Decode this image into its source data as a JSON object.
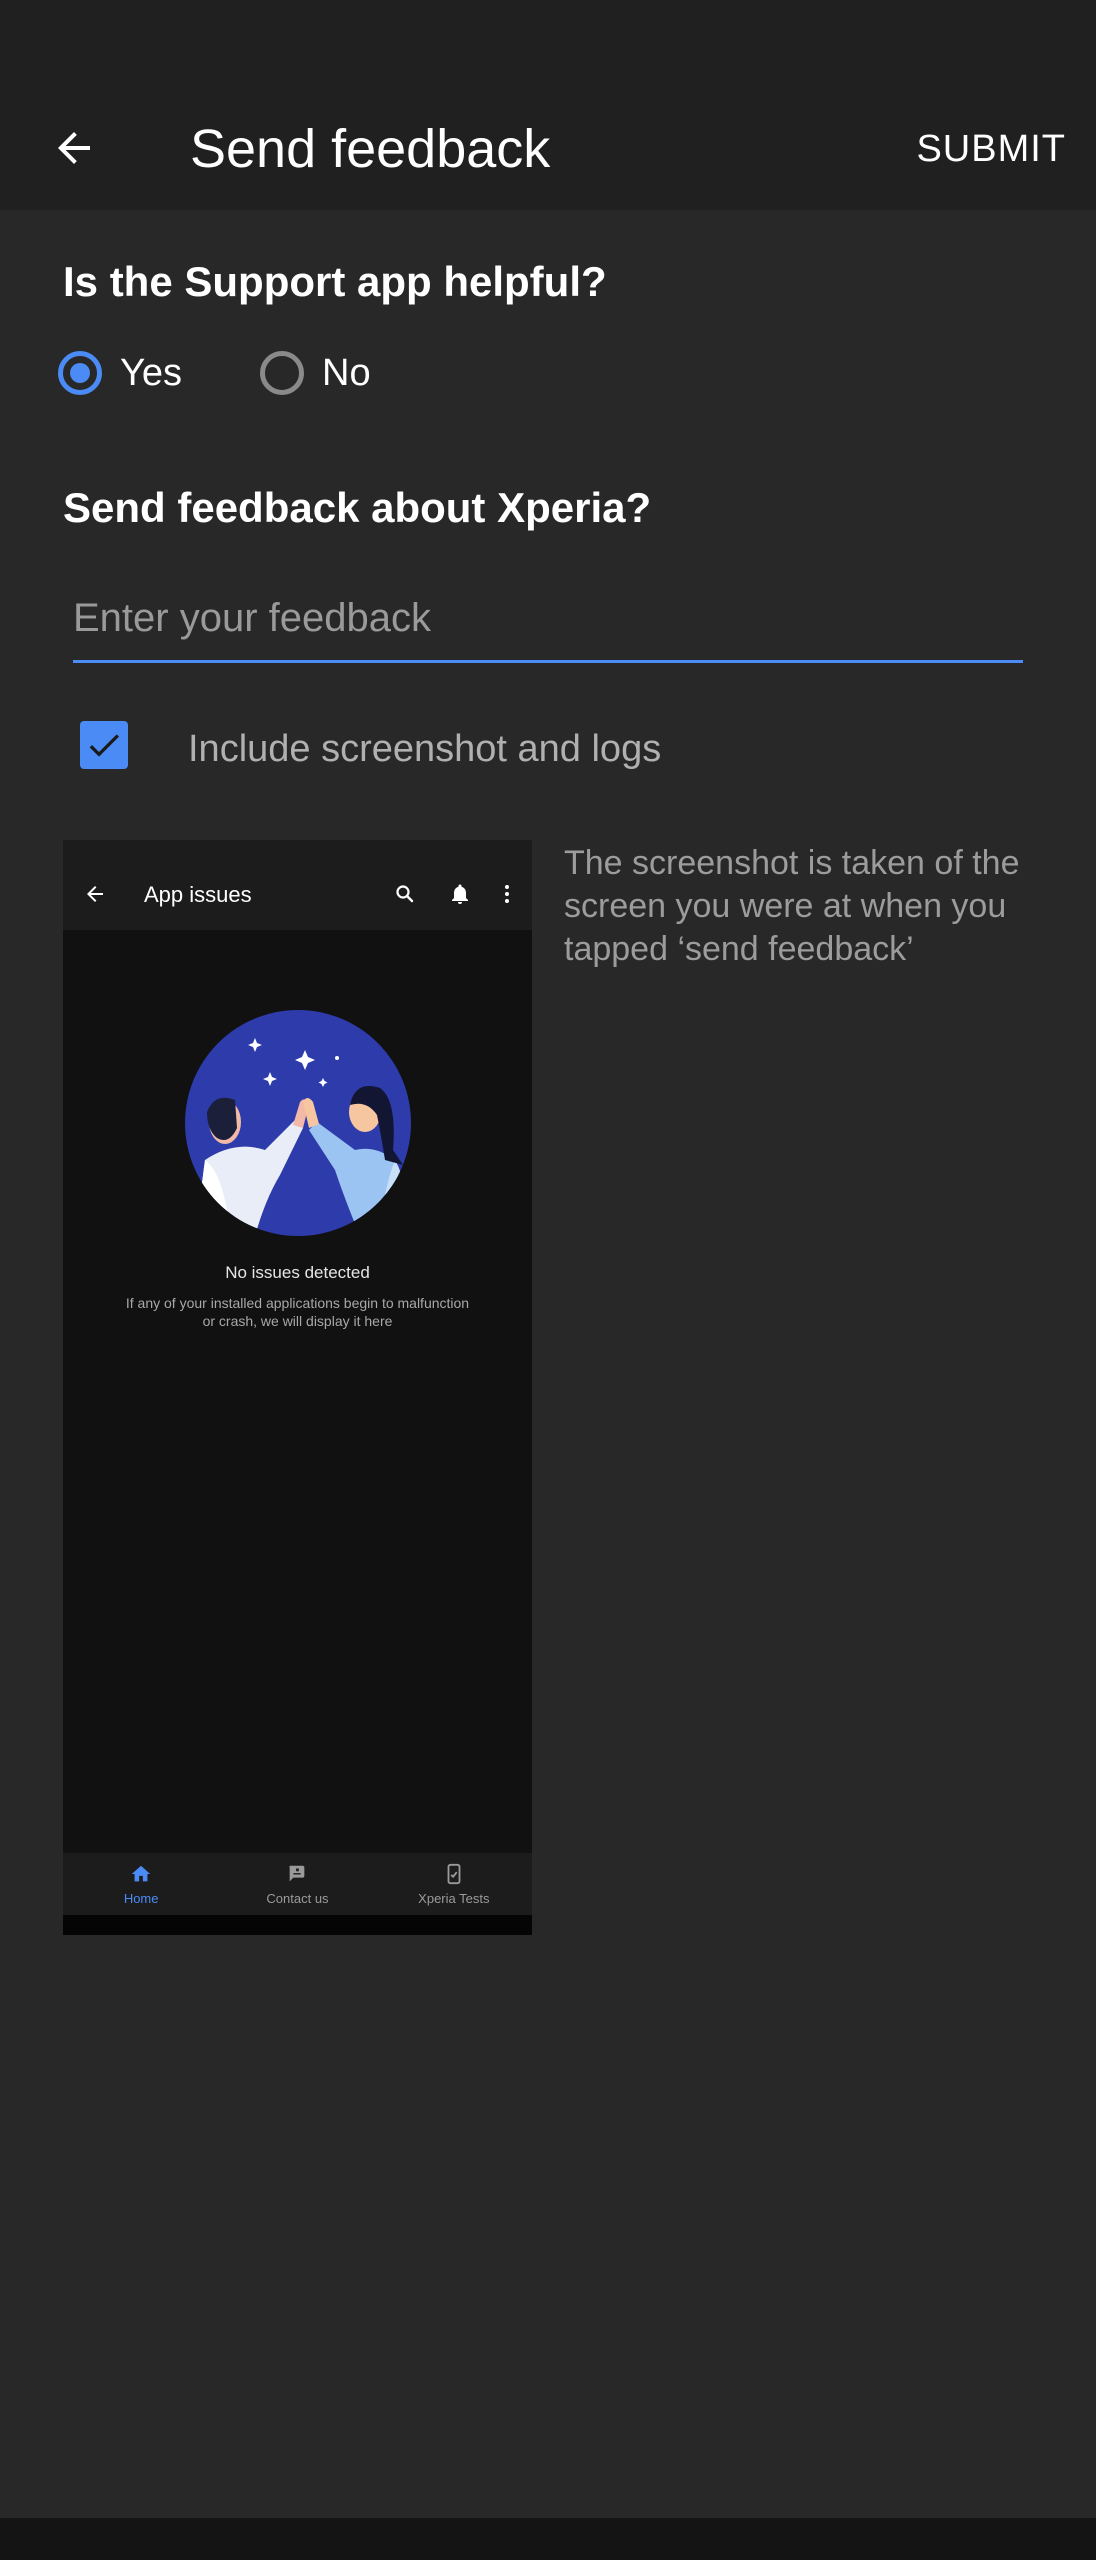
{
  "appbar": {
    "title": "Send feedback",
    "submit_label": "SUBMIT"
  },
  "question1": {
    "title": "Is the Support app helpful?",
    "options": [
      {
        "label": "Yes",
        "selected": true
      },
      {
        "label": "No",
        "selected": false
      }
    ]
  },
  "question2": {
    "title": "Send feedback about Xperia?",
    "input_placeholder": "Enter your feedback",
    "input_value": ""
  },
  "include": {
    "label": "Include screenshot and logs",
    "checked": true
  },
  "screenshot": {
    "title": "App issues",
    "heading": "No issues detected",
    "body": "If any of your installed applications begin to malfunction or crash, we will display it here",
    "nav": [
      {
        "label": "Home",
        "icon": "home-icon",
        "active": true
      },
      {
        "label": "Contact us",
        "icon": "contact-icon",
        "active": false
      },
      {
        "label": "Xperia Tests",
        "icon": "phone-test-icon",
        "active": false
      }
    ]
  },
  "description": "The screenshot is taken of the screen you were at when you tapped ‘send feedback’",
  "colors": {
    "accent": "#4a8bf5",
    "background": "#282828",
    "appbar": "#202020"
  }
}
